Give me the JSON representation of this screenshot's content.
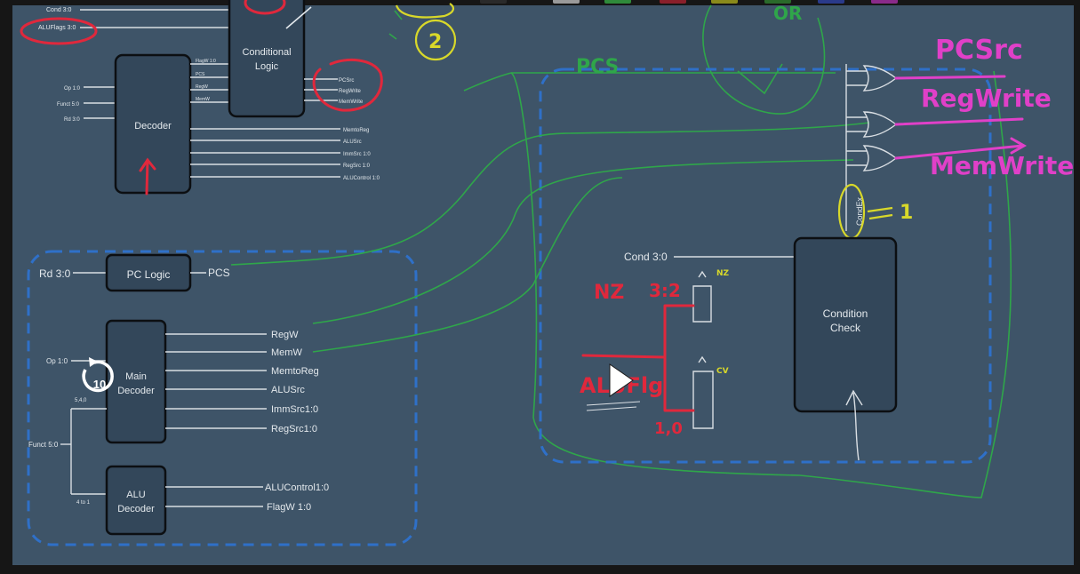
{
  "toolbar": {
    "swatch_colors": [
      "#2a2a2a",
      "#9a9a9a",
      "#2f8a3a",
      "#8a1f2a",
      "#8a8a1a",
      "#2a6a2a",
      "#2a3a8a",
      "#8a2a8a"
    ]
  },
  "top_decoder": {
    "inputs": [
      "Cond 3:0",
      "ALUFlags 3:0",
      "Op 1:0",
      "Funct 5:0",
      "Rd 3:0"
    ],
    "decoder_label": "Decoder",
    "decoder_outputs_to_logic": [
      "FlagW 1:0",
      "PCS",
      "RegW",
      "MemW"
    ],
    "conditional_logic_label": [
      "Conditional",
      "Logic"
    ],
    "logic_outputs": [
      "PCSrc",
      "RegWrite",
      "MemWrite"
    ],
    "decoder_outputs": [
      "MemtoReg",
      "ALUSrc",
      "ImmSrc 1:0",
      "RegSrc 1:0",
      "ALUControl 1:0"
    ]
  },
  "decoder_detail": {
    "rd_label": "Rd 3:0",
    "pc_logic_label": "PC Logic",
    "pcs_label": "PCS",
    "op_label": "Op 1:0",
    "main_decoder_label": [
      "Main",
      "Decoder"
    ],
    "funct_label": "Funct 5:0",
    "bits_main": "5,4,0",
    "bits_alu": "4 to 1",
    "main_outputs": [
      "RegW",
      "MemW",
      "MemtoReg",
      "ALUSrc",
      "ImmSrc1:0",
      "RegSrc1:0"
    ],
    "alu_decoder_label": [
      "ALU",
      "Decoder"
    ],
    "alu_outputs": [
      "ALUControl1:0",
      "FlagW 1:0"
    ]
  },
  "cond_logic_detail": {
    "cond_input": "Cond 3:0",
    "condition_check_label": [
      "Condition",
      "Check"
    ],
    "condex_label": "CondEx",
    "pcs_label": "PCS"
  },
  "annotations": {
    "circled_number": "2",
    "top_scribble": "OR",
    "pcsrc": "PCSrc",
    "regwrite": "RegWrite",
    "memwrite": "MemWrite",
    "condex_value": "1",
    "nz_label": "NZ",
    "nz_bits": "3:2",
    "aluflags_label": "ALUFlg",
    "cv_bits": "1,0",
    "reg_top_small": "NZ",
    "reg_bottom_small": "CV"
  },
  "player": {
    "replay_seconds": "10",
    "play_icon": "play"
  }
}
